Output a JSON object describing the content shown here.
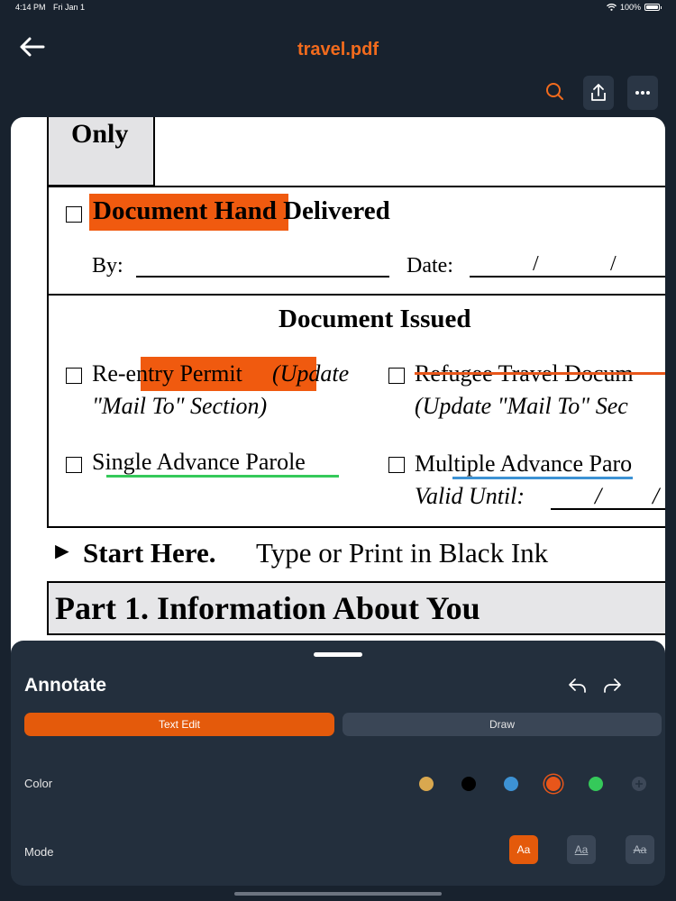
{
  "status": {
    "time": "4:14 PM",
    "date": "Fri Jan 1",
    "battery": "100%"
  },
  "nav": {
    "title": "travel.pdf"
  },
  "doc": {
    "cell_label": "Only",
    "hand_delivered": "Document Hand Delivered",
    "by_label": "By:",
    "date_label": "Date:",
    "date_slash1": "/",
    "date_slash2": "/",
    "issued_heading": "Document Issued",
    "reentry": "Re-entry Permit",
    "reentry_update": "(Update",
    "reentry_mail": "\"Mail To\" Section)",
    "refugee": "Refugee Travel Docum",
    "refugee_update": "(Update \"Mail To\" Sec",
    "single_parole": "Single Advance Parole",
    "multiple_parole": "Multiple Advance Paro",
    "valid_until": "Valid Until:",
    "valid_slash1": "/",
    "valid_slash2": "/",
    "start_arrow": "►",
    "start_here": "Start Here.",
    "start_instruction": "Type or Print in Black Ink",
    "part1": "Part 1.  Information About You"
  },
  "annotate": {
    "title": "Annotate",
    "tab_text_edit": "Text Edit",
    "tab_draw": "Draw",
    "active_tab": "Text Edit",
    "color_label": "Color",
    "mode_label": "Mode",
    "colors": [
      "#d9a84f",
      "#000000",
      "#3d92d4",
      "#e8561a",
      "#35c95a"
    ],
    "selected_color": "#e8561a",
    "modes": [
      "Aa",
      "Aa",
      "Aa"
    ],
    "selected_mode": 0
  }
}
